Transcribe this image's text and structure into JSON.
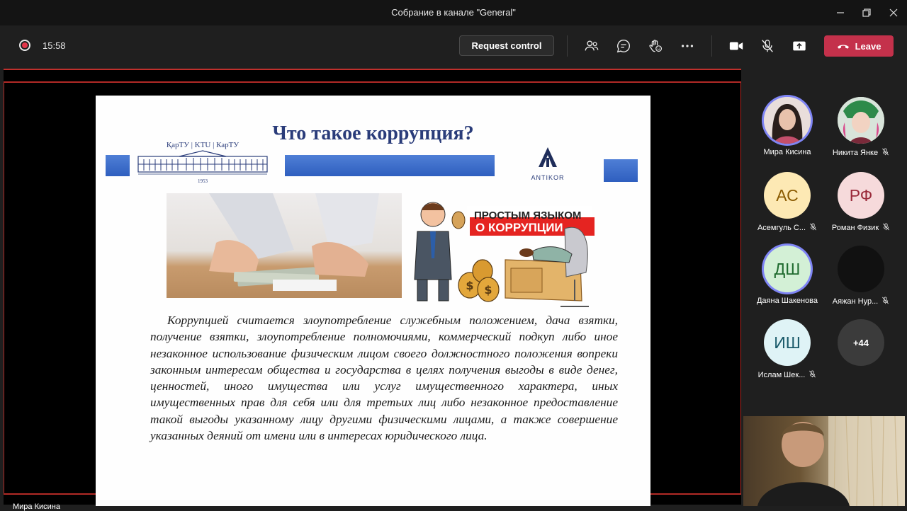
{
  "window": {
    "title": "Собрание в канале \"General\""
  },
  "toolbar": {
    "timer": "15:58",
    "request_control_label": "Request control",
    "leave_label": "Leave",
    "leave_color": "#c4314b",
    "record_color": "#e3364a"
  },
  "slide": {
    "title": "Что такое коррупция?",
    "logo_caption": "ҚарТУ | KTU | КарТУ",
    "logo_year": "1953",
    "antikor_label": "ANTIKOR",
    "banner_line1": "ПРОСТЫМ ЯЗЫКОМ",
    "banner_line2": "О КОРРУПЦИИ",
    "body": "Коррупцией считается злоупотребление служебным положением, дача взятки, получение взятки, злоупотребление полномочиями, коммерческий подкуп либо иное незаконное использование физическим лицом своего должностного положения вопреки законным интересам общества и государства в целях получения выгоды в виде денег, ценностей, иного имущества или услуг имущественного характера, иных имущественных прав для себя или для третьих лиц либо незаконное предоставление такой выгоды указанному лицу другими физическими лицами, а также совершение указанных деяний от имени или в интересах юридического лица."
  },
  "stage": {
    "presenter_name": "Мира Кисина"
  },
  "participants": [
    {
      "name": "Мира Кисина",
      "initials": "",
      "muted": false,
      "speaking": true
    },
    {
      "name": "Никита Янке",
      "initials": "",
      "muted": true,
      "speaking": false
    },
    {
      "name": "Асемгуль С...",
      "initials": "АС",
      "muted": true,
      "speaking": false,
      "color": "#fde9b4"
    },
    {
      "name": "Роман Физик",
      "initials": "РФ",
      "muted": true,
      "speaking": false,
      "color": "#f6dadb"
    },
    {
      "name": "Даяна Шакенова",
      "initials": "ДШ",
      "muted": false,
      "speaking": true,
      "color": "#d3f0d6"
    },
    {
      "name": "Аяжан Нур...",
      "initials": "",
      "muted": true,
      "speaking": false,
      "color": "#111111"
    },
    {
      "name": "Ислам Шек...",
      "initials": "ИШ",
      "muted": true,
      "speaking": false,
      "color": "#dff3f6"
    }
  ],
  "overflow_count": "+44"
}
